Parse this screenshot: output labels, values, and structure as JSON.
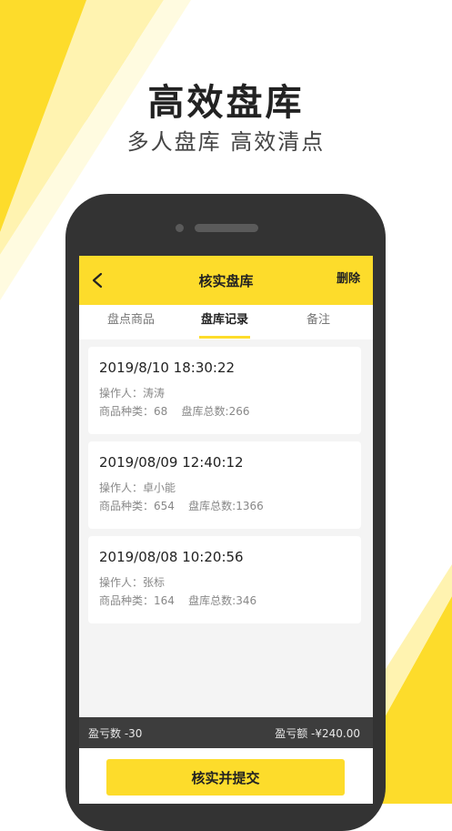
{
  "promo": {
    "headline": "高效盘库",
    "subheadline": "多人盘库 高效清点"
  },
  "colors": {
    "accent": "#fddc2b",
    "dark": "#333333"
  },
  "nav": {
    "back_icon": "chevron-left-icon",
    "title": "核实盘库",
    "action": "删除"
  },
  "tabs": [
    {
      "label": "盘点商品",
      "active": false
    },
    {
      "label": "盘库记录",
      "active": true
    },
    {
      "label": "备注",
      "active": false
    }
  ],
  "records": [
    {
      "time": "2019/8/10 18:30:22",
      "operator": "操作人：涛涛",
      "stats": "商品种类：68    盘库总数:266"
    },
    {
      "time": "2019/08/09 12:40:12",
      "operator": "操作人：卓小能",
      "stats": "商品种类：654    盘库总数:1366"
    },
    {
      "time": "2019/08/08 10:20:56",
      "operator": "操作人：张标",
      "stats": "商品种类：164    盘库总数:346"
    }
  ],
  "summary": {
    "profit_count": "盈亏数 -30",
    "profit_amount": "盈亏额 -¥240.00"
  },
  "submit_label": "核实并提交"
}
